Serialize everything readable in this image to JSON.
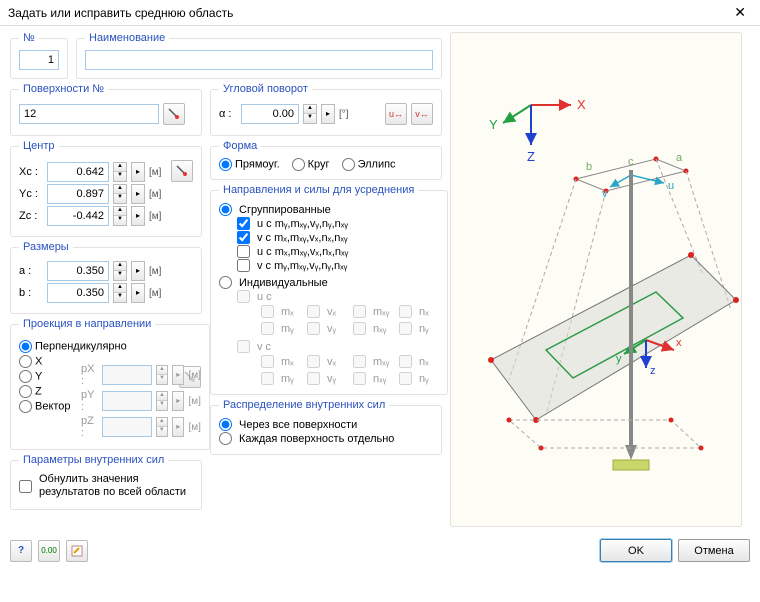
{
  "window": {
    "title": "Задать или исправить среднюю область"
  },
  "number": {
    "legend": "№",
    "value": "1"
  },
  "name": {
    "legend": "Наименование",
    "value": ""
  },
  "surfaces": {
    "legend": "Поверхности №",
    "value": "12"
  },
  "rotation": {
    "legend": "Угловой поворот",
    "alpha_label": "α :",
    "value": "0.00",
    "unit": "[°]"
  },
  "center": {
    "legend": "Центр",
    "xc_label": "Xc :",
    "xc": "0.642",
    "yc_label": "Yc :",
    "yc": "0.897",
    "zc_label": "Zc :",
    "zc": "-0.442",
    "unit": "[м]"
  },
  "shape": {
    "legend": "Форма",
    "rect": "Прямоуг.",
    "circle": "Круг",
    "ellipse": "Эллипс"
  },
  "dims": {
    "legend": "Размеры",
    "a_label": "a :",
    "a": "0.350",
    "b_label": "b :",
    "b": "0.350",
    "unit": "[м]"
  },
  "dirforces": {
    "legend": "Направления и силы для усреднения",
    "grouped": "Сгруппированные",
    "g1": "u с mᵧ,mₓᵧ,vᵧ,nᵧ,nₓᵧ",
    "g2": "v с mₓ,mₓᵧ,vₓ,nₓ,nₓᵧ",
    "g3": "u с mₓ,mₓᵧ,vₓ,nₓ,nₓᵧ",
    "g4": "v с mᵧ,mₓᵧ,vᵧ,nᵧ,nₓᵧ",
    "individual": "Индивидуальные",
    "uc": "u с",
    "vc": "v с",
    "mx": "mₓ",
    "vx": "vₓ",
    "mxy": "mₓᵧ",
    "nx": "nₓ",
    "my": "mᵧ",
    "vy": "vᵧ",
    "nxy": "nₓᵧ",
    "ny": "nᵧ"
  },
  "projection": {
    "legend": "Проекция в направлении",
    "perp": "Перпендикулярно",
    "x": "X",
    "y": "Y",
    "z": "Z",
    "vector": "Вектор",
    "px": "pX :",
    "py": "pY :",
    "pz": "pZ :",
    "unit": "[м]"
  },
  "internal": {
    "legend": "Параметры внутренних сил",
    "zero": "Обнулить значения результатов по всей области"
  },
  "distribution": {
    "legend": "Распределение внутренних сил",
    "all": "Через все поверхности",
    "each": "Каждая поверхность отдельно"
  },
  "footer": {
    "ok": "OK",
    "cancel": "Отмена"
  },
  "axis": {
    "x": "X",
    "y": "Y",
    "z": "Z"
  }
}
